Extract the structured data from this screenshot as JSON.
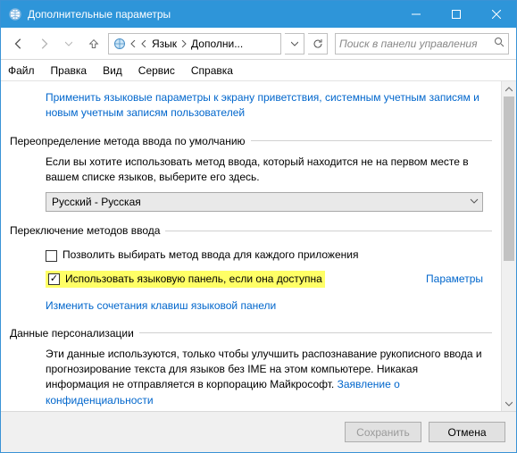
{
  "title": "Дополнительные параметры",
  "breadcrumb": {
    "c1": "Язык",
    "c2": "Дополни..."
  },
  "search_placeholder": "Поиск в панели управления",
  "menu": {
    "file": "Файл",
    "edit": "Правка",
    "view": "Вид",
    "service": "Сервис",
    "help": "Справка"
  },
  "top_link": "Применить языковые параметры к экрану приветствия, системным учетным записям и новым учетным записям пользователей",
  "sec1": {
    "legend": "Переопределение метода ввода по умолчанию",
    "desc": "Если вы хотите использовать метод ввода, который находится не на первом месте в вашем списке языков, выберите его здесь.",
    "select_value": "Русский - Русская"
  },
  "sec2": {
    "legend": "Переключение методов ввода",
    "chk1": "Позволить выбирать метод ввода для каждого приложения",
    "chk2": "Использовать языковую панель, если она доступна",
    "params": "Параметры",
    "link": "Изменить сочетания клавиш языковой панели"
  },
  "sec3": {
    "legend": "Данные персонализации",
    "desc": "Эти данные используются, только чтобы улучшить распознавание рукописного ввода и прогнозирование текста для языков без IME на этом компьютере. Никакая информация не отправляется в корпорацию Майкрософт. ",
    "link": "Заявление о конфиденциальности"
  },
  "footer": {
    "save": "Сохранить",
    "cancel": "Отмена"
  }
}
